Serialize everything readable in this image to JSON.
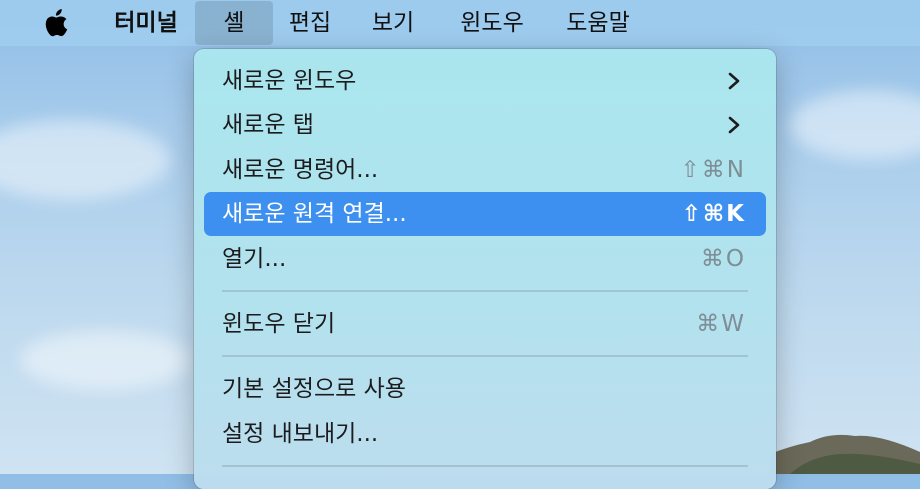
{
  "menubar": {
    "apple_icon": "apple-icon",
    "items": [
      "터미널",
      "셸",
      "편집",
      "보기",
      "윈도우",
      "도움말"
    ]
  },
  "shell_menu": {
    "items": [
      {
        "label": "새로운 윈도우",
        "shortcut": "",
        "submenu": true
      },
      {
        "label": "새로운 탭",
        "shortcut": "",
        "submenu": true
      },
      {
        "label": "새로운 명령어...",
        "shortcut": "⇧⌘N",
        "submenu": false
      },
      {
        "label": "새로운 원격 연결...",
        "shortcut": "⇧⌘K",
        "submenu": false,
        "selected": true
      },
      {
        "label": "열기...",
        "shortcut": "⌘O",
        "submenu": false
      },
      {
        "label": "윈도우 닫기",
        "shortcut": "⌘W",
        "submenu": false
      },
      {
        "label": "기본 설정으로 사용",
        "shortcut": "",
        "submenu": false
      },
      {
        "label": "설정 내보내기...",
        "shortcut": "",
        "submenu": false
      }
    ]
  },
  "colors": {
    "highlight": "#3d8ff0",
    "menubar": "#a0cef0",
    "menu_bg": "#aee2ee"
  }
}
